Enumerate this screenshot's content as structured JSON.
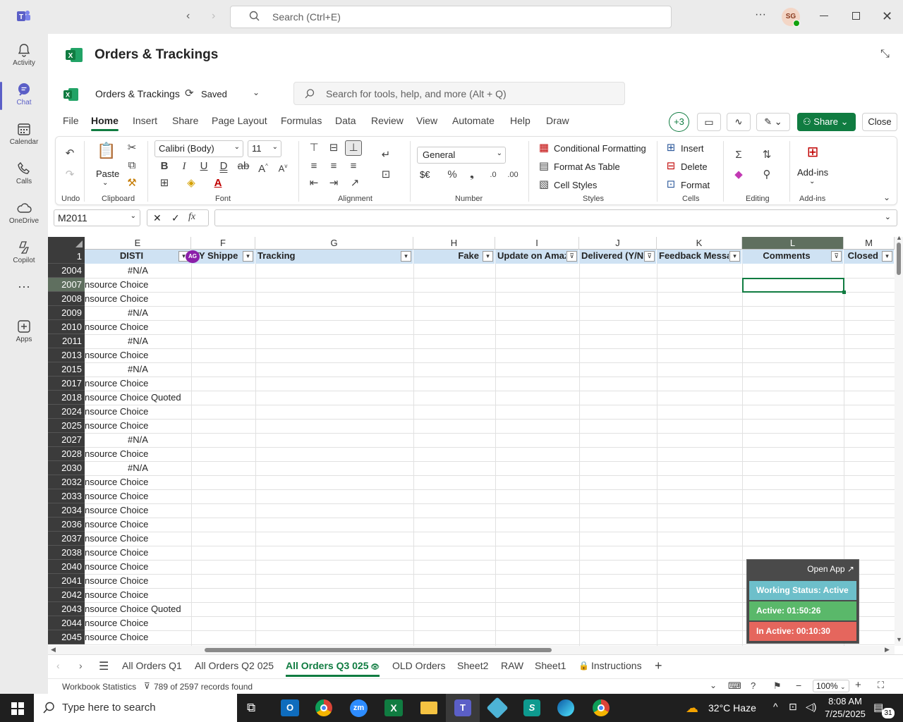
{
  "teams": {
    "search_placeholder": "Search (Ctrl+E)",
    "avatar": "SG",
    "nav": [
      {
        "label": "Activity"
      },
      {
        "label": "Chat"
      },
      {
        "label": "Calendar"
      },
      {
        "label": "Calls"
      },
      {
        "label": "OneDrive"
      },
      {
        "label": "Copilot"
      },
      {
        "label": ""
      },
      {
        "label": "Apps"
      }
    ]
  },
  "app": {
    "title": "Orders & Trackings",
    "doc_name": "Orders & Trackings",
    "saved": "Saved",
    "tool_search": "Search for tools, help, and more (Alt + Q)"
  },
  "menu": {
    "tabs": [
      "File",
      "Home",
      "Insert",
      "Share",
      "Page Layout",
      "Formulas",
      "Data",
      "Review",
      "View",
      "Automate",
      "Help",
      "Draw"
    ],
    "collab_count": "+3",
    "share": "Share",
    "close": "Close"
  },
  "ribbon": {
    "groups": {
      "undo": "Undo",
      "clipboard": "Clipboard",
      "font": "Font",
      "alignment": "Alignment",
      "number": "Number",
      "styles": "Styles",
      "cells": "Cells",
      "editing": "Editing",
      "addins": "Add-ins"
    },
    "paste": "Paste",
    "font_name": "Calibri (Body)",
    "font_size": "11",
    "number_format": "General",
    "currency": "$€",
    "conditional": "Conditional Formatting",
    "format_table": "Format As Table",
    "cell_styles": "Cell Styles",
    "insert": "Insert",
    "delete": "Delete",
    "format": "Format",
    "addins_btn": "Add-ins"
  },
  "formula": {
    "name_box": "M2011",
    "fx": "fx",
    "value": ""
  },
  "columns": [
    {
      "letter": "E",
      "header": "DISTI"
    },
    {
      "letter": "F",
      "header": "TY Shippe"
    },
    {
      "letter": "G",
      "header": "Tracking"
    },
    {
      "letter": "H",
      "header": "Fake"
    },
    {
      "letter": "I",
      "header": "Update on Amaz"
    },
    {
      "letter": "J",
      "header": "Delivered (Y/N"
    },
    {
      "letter": "K",
      "header": "Feedback Messa"
    },
    {
      "letter": "L",
      "header": "Comments"
    },
    {
      "letter": "M",
      "header": "Closed"
    }
  ],
  "header_row": "1",
  "presence_badge": "AG",
  "rows": [
    {
      "n": "2004",
      "e": "#N/A"
    },
    {
      "n": "2007",
      "e": "nsource Choice"
    },
    {
      "n": "2008",
      "e": "nsource Choice"
    },
    {
      "n": "2009",
      "e": "#N/A"
    },
    {
      "n": "2010",
      "e": "nsource Choice"
    },
    {
      "n": "2011",
      "e": "#N/A"
    },
    {
      "n": "2013",
      "e": "nsource Choice"
    },
    {
      "n": "2015",
      "e": "#N/A"
    },
    {
      "n": "2017",
      "e": "nsource Choice"
    },
    {
      "n": "2018",
      "e": "nsource Choice Quoted"
    },
    {
      "n": "2024",
      "e": "nsource Choice"
    },
    {
      "n": "2025",
      "e": "nsource Choice"
    },
    {
      "n": "2027",
      "e": "#N/A"
    },
    {
      "n": "2028",
      "e": "nsource Choice"
    },
    {
      "n": "2030",
      "e": "#N/A"
    },
    {
      "n": "2032",
      "e": "nsource Choice"
    },
    {
      "n": "2033",
      "e": "nsource Choice"
    },
    {
      "n": "2034",
      "e": "nsource Choice"
    },
    {
      "n": "2036",
      "e": "nsource Choice"
    },
    {
      "n": "2037",
      "e": "nsource Choice"
    },
    {
      "n": "2038",
      "e": "nsource Choice"
    },
    {
      "n": "2040",
      "e": "nsource Choice"
    },
    {
      "n": "2041",
      "e": "nsource Choice"
    },
    {
      "n": "2042",
      "e": "nsource Choice"
    },
    {
      "n": "2043",
      "e": "nsource Choice Quoted"
    },
    {
      "n": "2044",
      "e": "nsource Choice"
    },
    {
      "n": "2045",
      "e": "nsource Choice"
    }
  ],
  "sheets": [
    "All Orders Q1",
    "All Orders Q2 025",
    "All Orders Q3 025",
    "OLD Orders",
    "Sheet2",
    "RAW",
    "Sheet1",
    "Instructions"
  ],
  "status": {
    "stats": "Workbook Statistics",
    "filter": "789 of 2597 records found",
    "zoom": "100%"
  },
  "widget": {
    "open_app": "Open App ↗",
    "working": "Working Status: Active",
    "active": "Active: 01:50:26",
    "inactive": "In Active: 00:10:30"
  },
  "taskbar": {
    "search": "Type here to search",
    "weather": "32°C  Haze",
    "time": "8:08 AM",
    "date": "7/25/2025",
    "notif": "31"
  },
  "colors": {
    "excel_green": "#107c41",
    "teams_purple": "#5b5fc7",
    "header_fill": "#cfe2f3"
  }
}
